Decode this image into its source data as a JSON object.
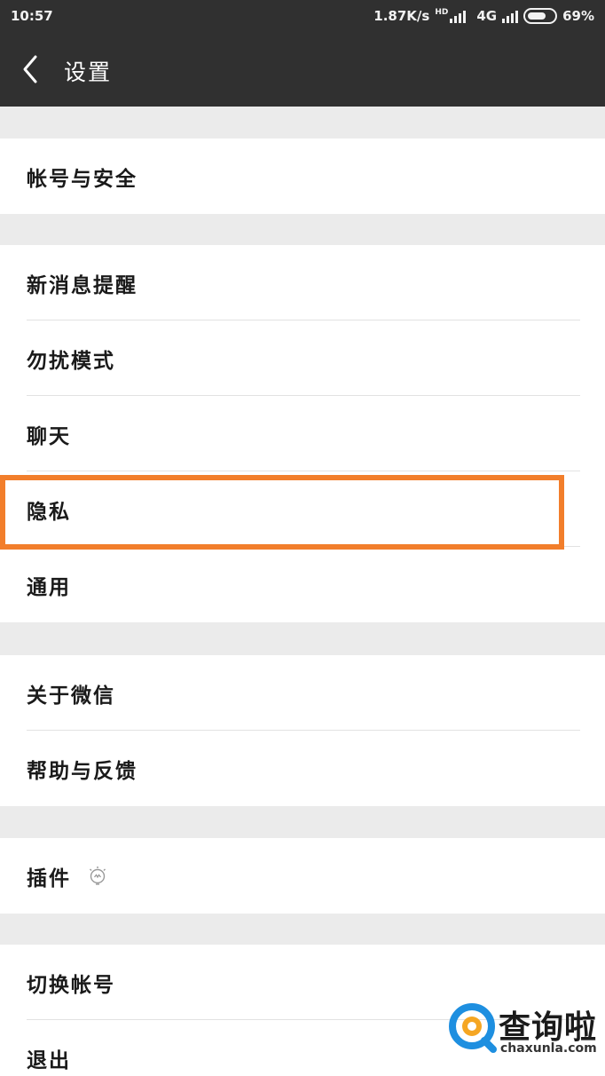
{
  "status_bar": {
    "time": "10:57",
    "net_speed": "1.87K/s",
    "hd": "HD",
    "network": "4G",
    "battery_percent": "69%",
    "battery_level": 0.69
  },
  "header": {
    "title": "设置",
    "back_icon": "chevron-left-icon"
  },
  "groups": [
    {
      "items": [
        {
          "label": "帐号与安全"
        }
      ]
    },
    {
      "items": [
        {
          "label": "新消息提醒"
        },
        {
          "label": "勿扰模式"
        },
        {
          "label": "聊天"
        },
        {
          "label": "隐私"
        },
        {
          "label": "通用"
        }
      ]
    },
    {
      "items": [
        {
          "label": "关于微信"
        },
        {
          "label": "帮助与反馈"
        }
      ]
    },
    {
      "items": [
        {
          "label": "插件",
          "icon": "lightbulb-icon"
        }
      ]
    },
    {
      "items": [
        {
          "label": "切换帐号"
        },
        {
          "label": "退出"
        }
      ]
    }
  ],
  "highlight": {
    "target": "隐私",
    "color": "#f27e2b"
  },
  "watermark": {
    "text": "查询啦",
    "url": "chaxunla.com",
    "colors": {
      "ring": "#1e8fe0",
      "accent": "#f5a623"
    }
  },
  "colors": {
    "header_bg": "#303030",
    "page_bg": "#ebebeb",
    "row_bg": "#ffffff",
    "divider": "#e2e2e2"
  }
}
